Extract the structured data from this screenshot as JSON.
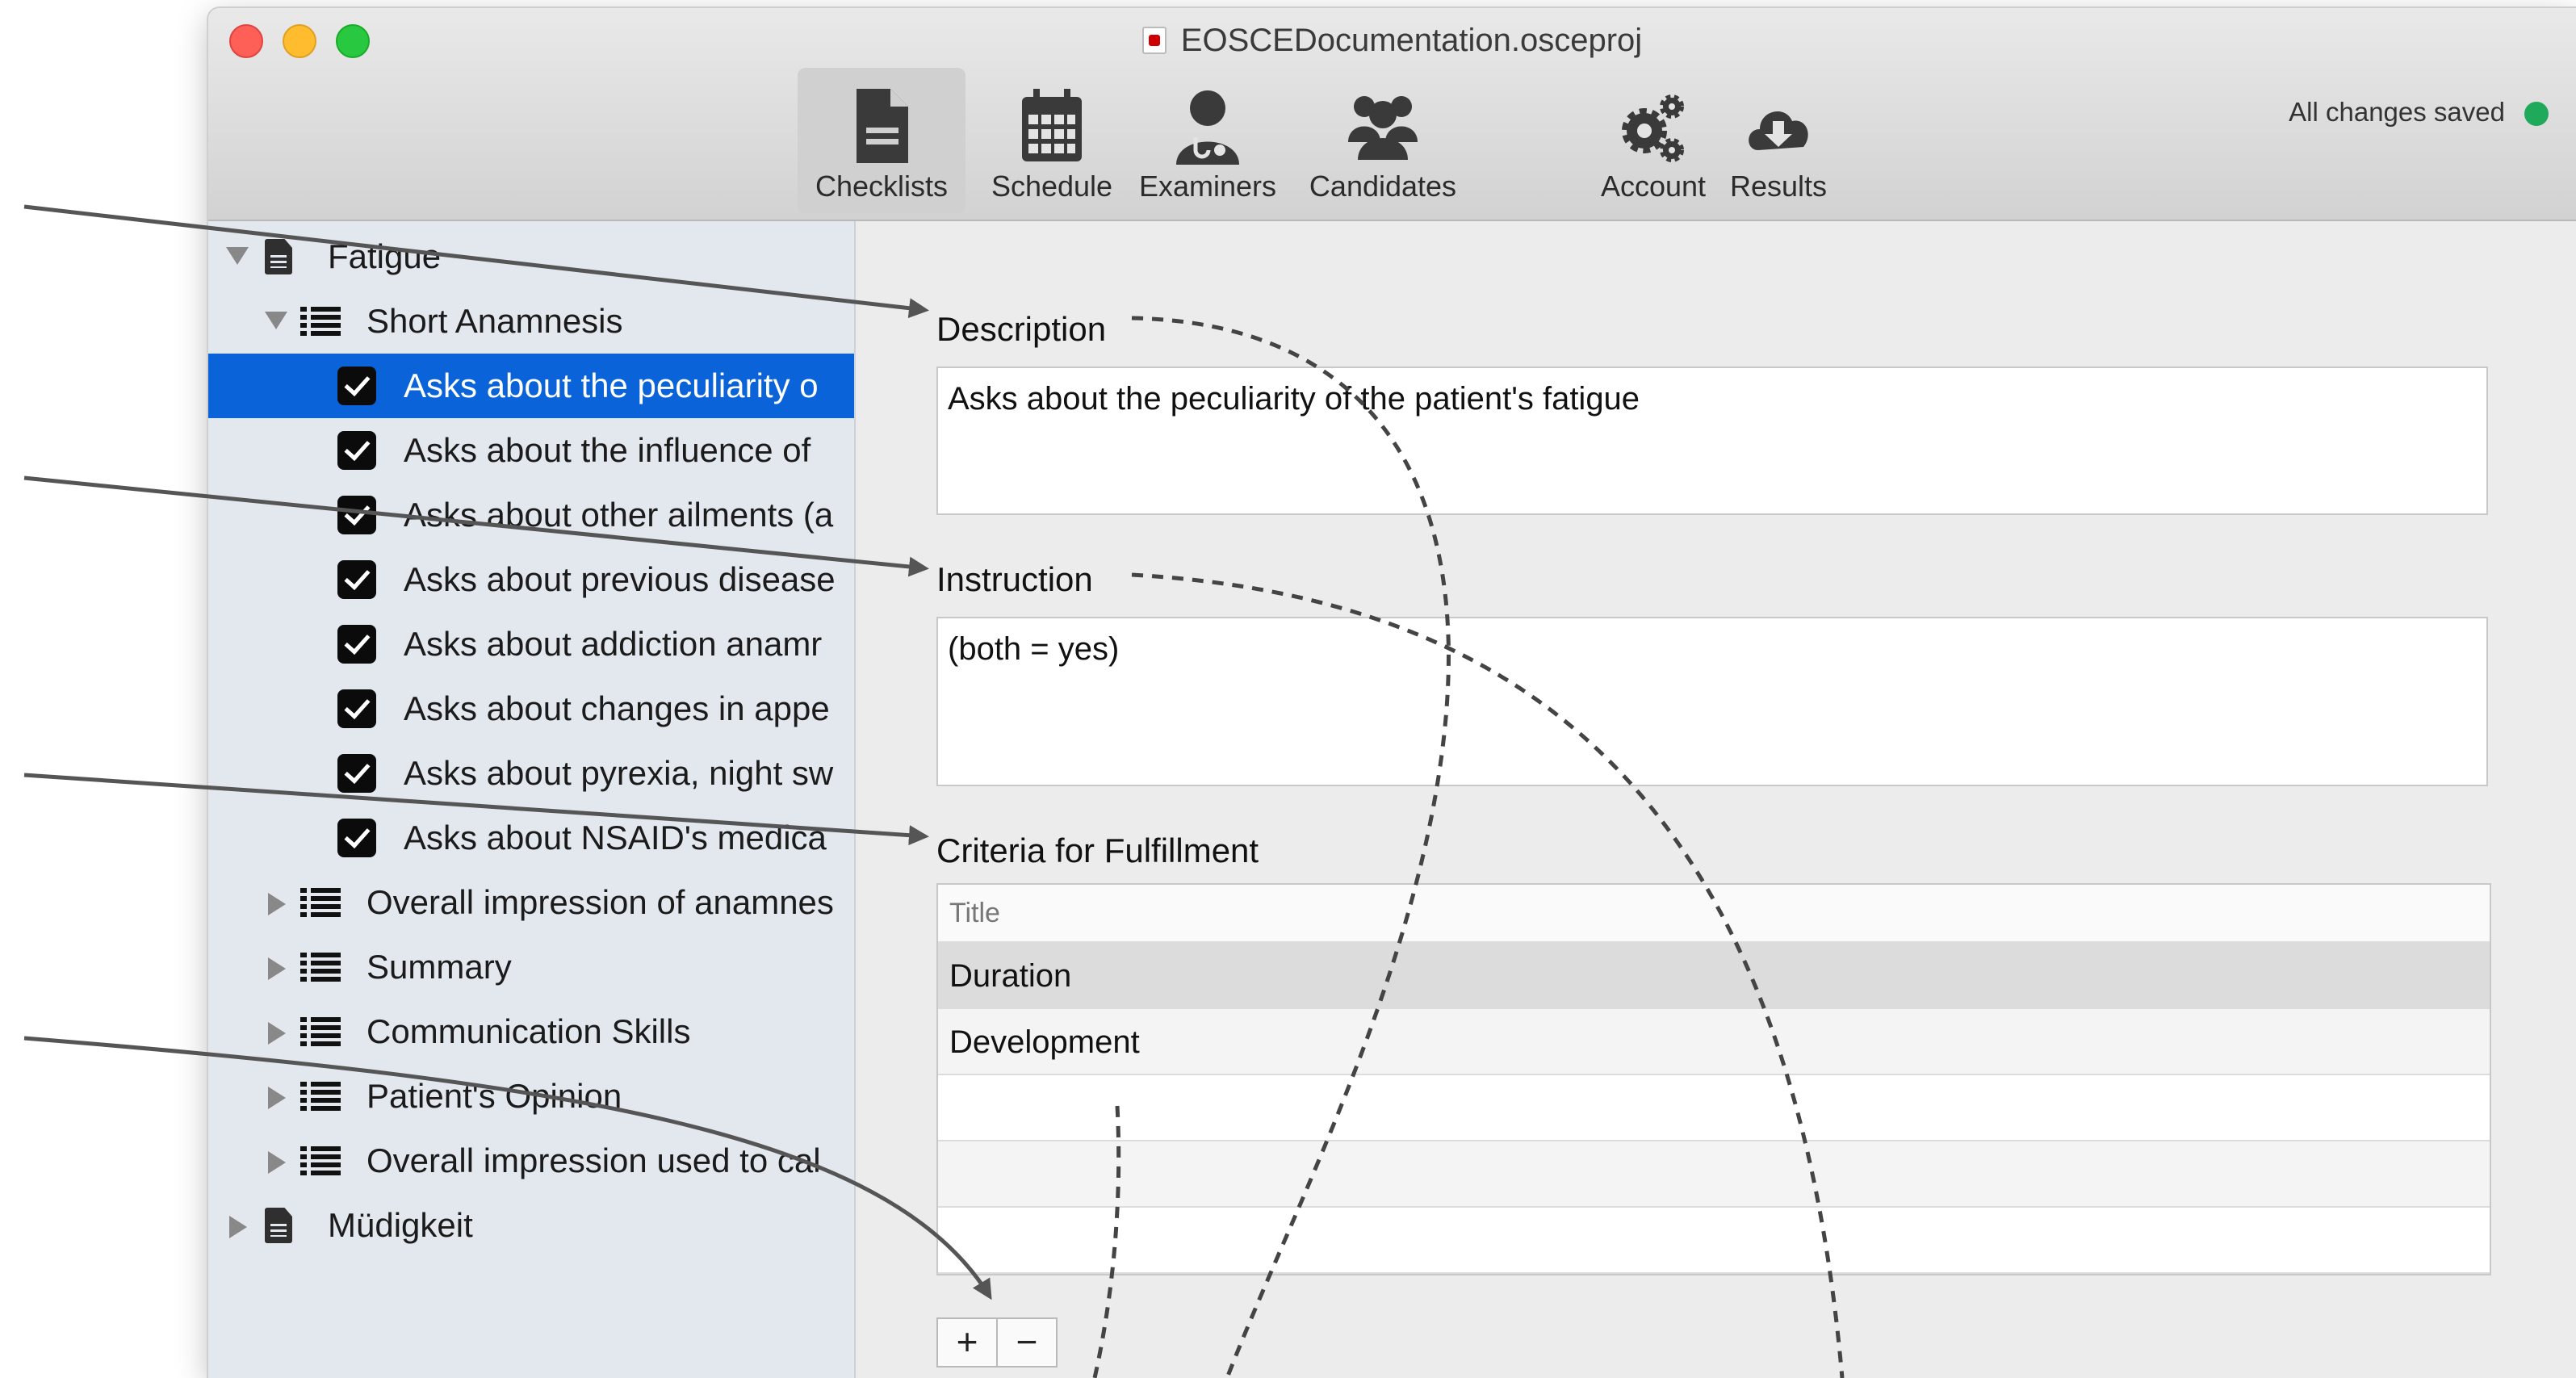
{
  "window": {
    "title": "EOSCEDocumentation.osceproj",
    "status_text": "All changes saved"
  },
  "toolbar": [
    {
      "label": "Checklists",
      "icon": "document-icon"
    },
    {
      "label": "Schedule",
      "icon": "calendar-icon"
    },
    {
      "label": "Examiners",
      "icon": "doctor-icon"
    },
    {
      "label": "Candidates",
      "icon": "group-icon"
    },
    {
      "label": "Account",
      "icon": "gears-icon"
    },
    {
      "label": "Results",
      "icon": "cloud-download-icon"
    }
  ],
  "sidebar": {
    "items": [
      {
        "label": "Fatigue"
      },
      {
        "label": "Short Anamnesis"
      },
      {
        "label": "Asks about the peculiarity o"
      },
      {
        "label": "Asks about the influence of"
      },
      {
        "label": "Asks about other ailments (a"
      },
      {
        "label": "Asks about previous disease"
      },
      {
        "label": "Asks about addiction anamr"
      },
      {
        "label": "Asks about changes in appe"
      },
      {
        "label": "Asks about pyrexia, night sw"
      },
      {
        "label": "Asks about NSAID's medica"
      },
      {
        "label": "Overall impression of anamnes"
      },
      {
        "label": "Summary"
      },
      {
        "label": "Communication Skills"
      },
      {
        "label": "Patient's Opinion"
      },
      {
        "label": "Overall impression used to cal"
      },
      {
        "label": "Müdigkeit"
      }
    ]
  },
  "detail": {
    "description_heading": "Description",
    "description_value": "Asks about the peculiarity of the patient's fatigue",
    "instruction_heading": "Instruction",
    "instruction_value": "(both = yes)",
    "criteria_heading": "Criteria for Fulfillment",
    "criteria_column": "Title",
    "criteria_rows": [
      "Duration",
      "Development"
    ],
    "add_label": "+",
    "remove_label": "−"
  },
  "colors": {
    "selection": "#0a63d8",
    "status_dot": "#1fa95a",
    "sidebar_bg": "#e3e7ee"
  }
}
